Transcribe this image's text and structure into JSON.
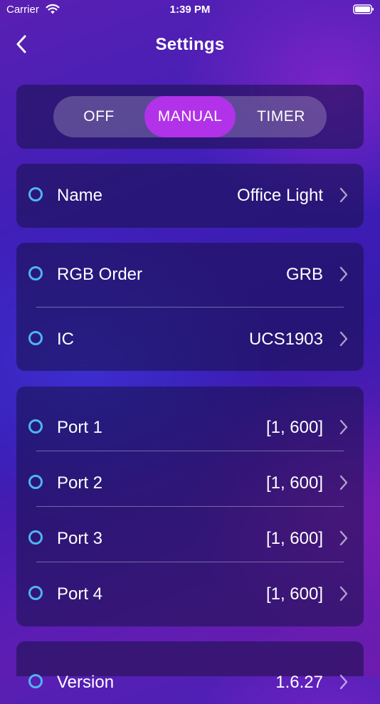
{
  "status_bar": {
    "carrier": "Carrier",
    "time": "1:39 PM"
  },
  "nav": {
    "title": "Settings"
  },
  "mode": {
    "options": [
      "OFF",
      "MANUAL",
      "TIMER"
    ],
    "selected": "MANUAL"
  },
  "device": {
    "name": {
      "label": "Name",
      "value": "Office Light"
    }
  },
  "hardware": {
    "rgb_order": {
      "label": "RGB Order",
      "value": "GRB"
    },
    "ic": {
      "label": "IC",
      "value": "UCS1903"
    }
  },
  "ports": [
    {
      "label": "Port 1",
      "value": "[1, 600]"
    },
    {
      "label": "Port 2",
      "value": "[1, 600]"
    },
    {
      "label": "Port 3",
      "value": "[1, 600]"
    },
    {
      "label": "Port 4",
      "value": "[1, 600]"
    }
  ],
  "about": {
    "version": {
      "label": "Version",
      "value": "1.6.27"
    }
  },
  "colors": {
    "accent": "#b132e8",
    "dot": "#4fb4f0"
  },
  "icons": [
    "wifi-icon",
    "battery-icon",
    "back-chevron-icon",
    "circle-indicator-icon",
    "chevron-right-icon"
  ]
}
